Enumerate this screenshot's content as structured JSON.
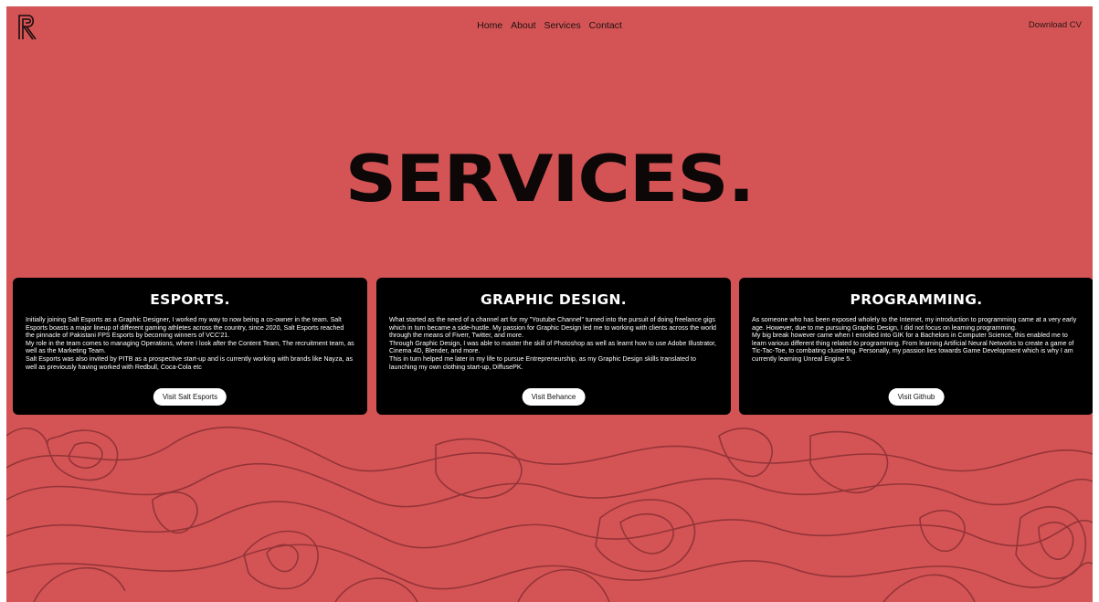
{
  "brand": {
    "logo_icon": "r-monogram-logo-icon"
  },
  "nav": {
    "items": [
      "Home",
      "About",
      "Services",
      "Contact"
    ]
  },
  "download_cv": "Download CV",
  "hero_title": "SERVICES.",
  "cards": [
    {
      "title": "ESPORTS.",
      "paragraphs": [
        "Initially joining Salt Esports as a Graphic Designer, I worked my way to now being a co-owner in the team. Salt Esports boasts a major lineup of different gaming athletes across the country, since 2020, Salt Esports reached the pinnacle of Pakistani FPS Esports by becoming winners of VCC'21.",
        "My role in the team comes to managing Operations, where I look after the Content Team, The recruitment team, as well as the Marketing Team.",
        "Salt Esports was also invited by PITB as a prospective start-up and is currently working with brands like Nayza, as well as previously having worked with Redbull, Coca-Cola etc"
      ],
      "button": "Visit Salt Esports"
    },
    {
      "title": "GRAPHIC DESIGN.",
      "paragraphs": [
        "What started as the need of a channel art for my \"Youtube Channel\" turned into the pursuit of doing freelance gigs which in turn became a side-hustle. My passion for Graphic Design led me to working with clients across the world through the means of Fiverr, Twitter, and more.",
        "Through Graphic Design, I was able to master the skill of Photoshop as well as learnt how to use Adobe Illustrator, Cinema 4D, Blender, and more.",
        "This in turn helped me later in my life to pursue Entrepreneurship, as my Graphic Design skills translated to launching my own clothing start-up, DiffusePK."
      ],
      "button": "Visit Behance"
    },
    {
      "title": "PROGRAMMING.",
      "paragraphs": [
        "As someone who has been exposed wholely to the Internet, my introduction to programming came at a very early age. However, due to me pursuing Graphic Design, I did not focus on learning programming.",
        "My big break however came when I enrolled into GIK for a Bachelors in Computer Science, this enabled me to learn various different thing related to programming. From learning Artificial Neural Networks to create a game of Tic-Tac-Toe, to combating clustering. Personally, my passion lies towards Game Development which is why I am currently learning Unreal Engine 5."
      ],
      "button": "Visit Github"
    }
  ],
  "colors": {
    "background": "#d45455",
    "card": "#000000",
    "topo_lines": "#8a2f33"
  }
}
